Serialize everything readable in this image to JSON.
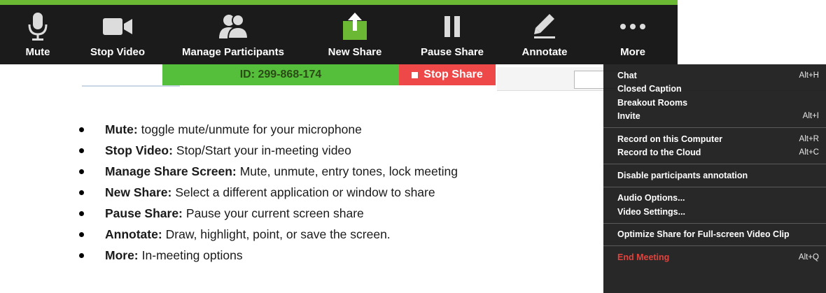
{
  "toolbar": {
    "items": [
      {
        "label": "Mute"
      },
      {
        "label": "Stop Video"
      },
      {
        "label": "Manage Participants"
      },
      {
        "label": "New Share"
      },
      {
        "label": "Pause Share"
      },
      {
        "label": "Annotate"
      },
      {
        "label": "More"
      }
    ]
  },
  "meeting": {
    "id_text": "ID: 299-868-174",
    "stop_share_label": "Stop Share"
  },
  "bullets": [
    {
      "term": "Mute:",
      "desc": "toggle mute/unmute for your microphone"
    },
    {
      "term": "Stop Video:",
      "desc": "Stop/Start your in-meeting video"
    },
    {
      "term": "Manage Share Screen:",
      "desc": "Mute, unmute, entry tones, lock meeting"
    },
    {
      "term": "New Share:",
      "desc": "Select a different application or window to share"
    },
    {
      "term": "Pause Share:",
      "desc": "Pause your current screen share"
    },
    {
      "term": "Annotate:",
      "desc": "Draw, highlight, point, or save the screen."
    },
    {
      "term": "More:",
      "desc": "In-meeting options"
    }
  ],
  "more_menu": {
    "groups": [
      [
        {
          "label": "Chat",
          "shortcut": "Alt+H"
        },
        {
          "label": "Closed Caption",
          "shortcut": ""
        },
        {
          "label": "Breakout Rooms",
          "shortcut": ""
        },
        {
          "label": "Invite",
          "shortcut": "Alt+I"
        }
      ],
      [
        {
          "label": "Record on this Computer",
          "shortcut": "Alt+R"
        },
        {
          "label": "Record to the Cloud",
          "shortcut": "Alt+C"
        }
      ],
      [
        {
          "label": "Disable participants annotation",
          "shortcut": ""
        }
      ],
      [
        {
          "label": "Audio Options...",
          "shortcut": ""
        },
        {
          "label": "Video Settings...",
          "shortcut": ""
        }
      ],
      [
        {
          "label": "Optimize Share for Full-screen Video Clip",
          "shortcut": ""
        }
      ],
      [
        {
          "label": "End Meeting",
          "shortcut": "Alt+Q"
        }
      ]
    ]
  },
  "colors": {
    "toolbar_bg": "#1b1b1b",
    "accent_green": "#6ab833",
    "id_bar_green": "#55bf3b",
    "stop_red": "#ee4848",
    "end_meeting_red": "#e0433d"
  }
}
